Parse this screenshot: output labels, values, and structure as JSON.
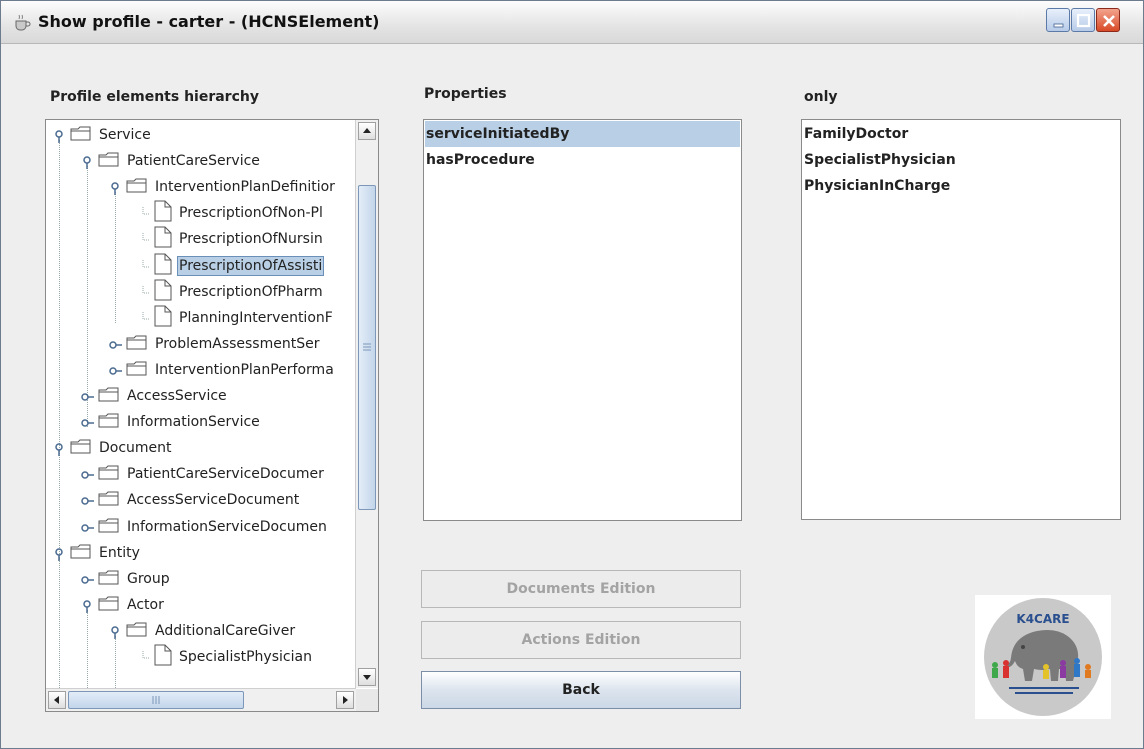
{
  "window": {
    "title": "Show profile - carter - (HCNSElement)"
  },
  "labels": {
    "hierarchy": "Profile elements hierarchy",
    "properties": "Properties",
    "values": "only"
  },
  "tree": {
    "rows": [
      {
        "label": "Service",
        "type": "folder",
        "expanded": true
      },
      {
        "label": "PatientCareService",
        "type": "folder",
        "expanded": true
      },
      {
        "label": "InterventionPlanDefinitior",
        "type": "folder",
        "expanded": true
      },
      {
        "label": "PrescriptionOfNon-Pl",
        "type": "leaf"
      },
      {
        "label": "PrescriptionOfNursin",
        "type": "leaf"
      },
      {
        "label": "PrescriptionOfAssisti",
        "type": "leaf",
        "selected": true
      },
      {
        "label": "PrescriptionOfPharm",
        "type": "leaf"
      },
      {
        "label": "PlanningInterventionF",
        "type": "leaf"
      },
      {
        "label": "ProblemAssessmentSer",
        "type": "folder",
        "expanded": false
      },
      {
        "label": "InterventionPlanPerforma",
        "type": "folder",
        "expanded": false
      },
      {
        "label": "AccessService",
        "type": "folder",
        "expanded": false
      },
      {
        "label": "InformationService",
        "type": "folder",
        "expanded": false
      },
      {
        "label": "Document",
        "type": "folder",
        "expanded": true
      },
      {
        "label": "PatientCareServiceDocumer",
        "type": "folder",
        "expanded": false
      },
      {
        "label": "AccessServiceDocument",
        "type": "folder",
        "expanded": false
      },
      {
        "label": "InformationServiceDocumen",
        "type": "folder",
        "expanded": false
      },
      {
        "label": "Entity",
        "type": "folder",
        "expanded": true
      },
      {
        "label": "Group",
        "type": "folder",
        "expanded": false
      },
      {
        "label": "Actor",
        "type": "folder",
        "expanded": true
      },
      {
        "label": "AdditionalCareGiver",
        "type": "folder",
        "expanded": true
      },
      {
        "label": "SpecialistPhysician",
        "type": "leaf"
      }
    ]
  },
  "properties": {
    "items": [
      {
        "label": "serviceInitiatedBy",
        "selected": true
      },
      {
        "label": "hasProcedure",
        "selected": false
      }
    ]
  },
  "values": {
    "items": [
      "FamilyDoctor",
      "SpecialistPhysician",
      "PhysicianInCharge"
    ]
  },
  "buttons": {
    "documents": "Documents Edition",
    "actions": "Actions Edition",
    "back": "Back"
  },
  "logo": {
    "text": "K4CARE"
  },
  "colors": {
    "selection": "#b8cfe5",
    "logo_text": "#2a4f8f"
  }
}
